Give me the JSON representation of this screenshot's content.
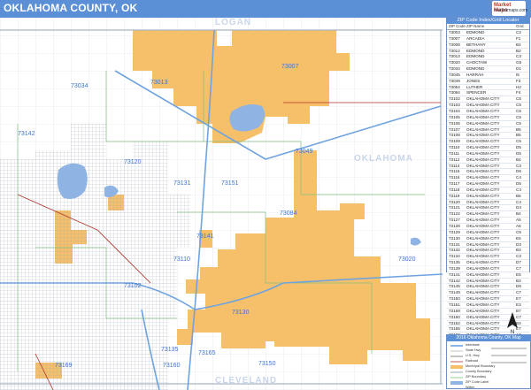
{
  "header": {
    "title": "OKLAHOMA COUNTY, OK",
    "brand_line1": "Market Maps",
    "brand_line2": "marketmaps.com"
  },
  "counties": {
    "north": "LOGAN",
    "east": "OKLAHOMA",
    "south": "CLEVELAND"
  },
  "zip_labels": [
    {
      "id": "z73007",
      "text": "73007"
    },
    {
      "id": "z73013",
      "text": "73013"
    },
    {
      "id": "z73034",
      "text": "73034"
    },
    {
      "id": "z73142",
      "text": "73142"
    },
    {
      "id": "z73120",
      "text": "73120"
    },
    {
      "id": "z73131",
      "text": "73131"
    },
    {
      "id": "z73151",
      "text": "73151"
    },
    {
      "id": "z73049",
      "text": "73049"
    },
    {
      "id": "z73084",
      "text": "73084"
    },
    {
      "id": "z73141",
      "text": "73141"
    },
    {
      "id": "z73130",
      "text": "73130"
    },
    {
      "id": "z73110",
      "text": "73110"
    },
    {
      "id": "z73150",
      "text": "73150"
    },
    {
      "id": "z73165",
      "text": "73165"
    },
    {
      "id": "z73160",
      "text": "73160"
    },
    {
      "id": "z73135",
      "text": "73135"
    },
    {
      "id": "z73169",
      "text": "73169"
    },
    {
      "id": "z73020",
      "text": "73020"
    },
    {
      "id": "z73102",
      "text": "73102"
    }
  ],
  "locator": {
    "title": "ZIP Code Index/Grid Locator",
    "col_zip": "ZIP Code",
    "col_name": "ZIP Name",
    "col_grid": "Grid",
    "rows": [
      {
        "zip": "73003",
        "name": "EDMOND",
        "grid": "C2"
      },
      {
        "zip": "73007",
        "name": "ARCADIA",
        "grid": "F1"
      },
      {
        "zip": "73008",
        "name": "BETHANY",
        "grid": "B4"
      },
      {
        "zip": "73012",
        "name": "EDMOND",
        "grid": "B2"
      },
      {
        "zip": "73013",
        "name": "EDMOND",
        "grid": "C3"
      },
      {
        "zip": "73020",
        "name": "CHOCTAW",
        "grid": "G5"
      },
      {
        "zip": "73034",
        "name": "EDMOND",
        "grid": "D1"
      },
      {
        "zip": "73045",
        "name": "HARRAH",
        "grid": "I5"
      },
      {
        "zip": "73049",
        "name": "JONES",
        "grid": "F3"
      },
      {
        "zip": "73054",
        "name": "LUTHER",
        "grid": "H2"
      },
      {
        "zip": "73084",
        "name": "SPENCER",
        "grid": "F4"
      },
      {
        "zip": "73102",
        "name": "OKLAHOMA CITY",
        "grid": "C5"
      },
      {
        "zip": "73103",
        "name": "OKLAHOMA CITY",
        "grid": "C5"
      },
      {
        "zip": "73104",
        "name": "OKLAHOMA CITY",
        "grid": "C5"
      },
      {
        "zip": "73105",
        "name": "OKLAHOMA CITY",
        "grid": "C5"
      },
      {
        "zip": "73106",
        "name": "OKLAHOMA CITY",
        "grid": "C5"
      },
      {
        "zip": "73107",
        "name": "OKLAHOMA CITY",
        "grid": "B5"
      },
      {
        "zip": "73108",
        "name": "OKLAHOMA CITY",
        "grid": "B5"
      },
      {
        "zip": "73109",
        "name": "OKLAHOMA CITY",
        "grid": "C6"
      },
      {
        "zip": "73110",
        "name": "OKLAHOMA CITY",
        "grid": "D5"
      },
      {
        "zip": "73111",
        "name": "OKLAHOMA CITY",
        "grid": "D5"
      },
      {
        "zip": "73112",
        "name": "OKLAHOMA CITY",
        "grid": "B4"
      },
      {
        "zip": "73114",
        "name": "OKLAHOMA CITY",
        "grid": "C3"
      },
      {
        "zip": "73115",
        "name": "OKLAHOMA CITY",
        "grid": "D6"
      },
      {
        "zip": "73116",
        "name": "OKLAHOMA CITY",
        "grid": "C4"
      },
      {
        "zip": "73117",
        "name": "OKLAHOMA CITY",
        "grid": "D5"
      },
      {
        "zip": "73118",
        "name": "OKLAHOMA CITY",
        "grid": "C4"
      },
      {
        "zip": "73119",
        "name": "OKLAHOMA CITY",
        "grid": "B6"
      },
      {
        "zip": "73120",
        "name": "OKLAHOMA CITY",
        "grid": "C4"
      },
      {
        "zip": "73121",
        "name": "OKLAHOMA CITY",
        "grid": "D4"
      },
      {
        "zip": "73122",
        "name": "OKLAHOMA CITY",
        "grid": "B4"
      },
      {
        "zip": "73127",
        "name": "OKLAHOMA CITY",
        "grid": "A5"
      },
      {
        "zip": "73128",
        "name": "OKLAHOMA CITY",
        "grid": "A6"
      },
      {
        "zip": "73129",
        "name": "OKLAHOMA CITY",
        "grid": "C6"
      },
      {
        "zip": "73130",
        "name": "OKLAHOMA CITY",
        "grid": "E6"
      },
      {
        "zip": "73131",
        "name": "OKLAHOMA CITY",
        "grid": "D3"
      },
      {
        "zip": "73132",
        "name": "OKLAHOMA CITY",
        "grid": "B3"
      },
      {
        "zip": "73134",
        "name": "OKLAHOMA CITY",
        "grid": "C3"
      },
      {
        "zip": "73135",
        "name": "OKLAHOMA CITY",
        "grid": "D7"
      },
      {
        "zip": "73139",
        "name": "OKLAHOMA CITY",
        "grid": "C7"
      },
      {
        "zip": "73141",
        "name": "OKLAHOMA CITY",
        "grid": "E5"
      },
      {
        "zip": "73142",
        "name": "OKLAHOMA CITY",
        "grid": "B3"
      },
      {
        "zip": "73145",
        "name": "OKLAHOMA CITY",
        "grid": "D6"
      },
      {
        "zip": "73149",
        "name": "OKLAHOMA CITY",
        "grid": "C7"
      },
      {
        "zip": "73150",
        "name": "OKLAHOMA CITY",
        "grid": "E7"
      },
      {
        "zip": "73151",
        "name": "OKLAHOMA CITY",
        "grid": "E3"
      },
      {
        "zip": "73159",
        "name": "OKLAHOMA CITY",
        "grid": "B7"
      },
      {
        "zip": "73160",
        "name": "OKLAHOMA CITY",
        "grid": "C7"
      },
      {
        "zip": "73162",
        "name": "OKLAHOMA CITY",
        "grid": "B3"
      },
      {
        "zip": "73165",
        "name": "OKLAHOMA CITY",
        "grid": "E7"
      },
      {
        "zip": "73169",
        "name": "OKLAHOMA CITY",
        "grid": "A7"
      },
      {
        "zip": "73170",
        "name": "OKLAHOMA CITY",
        "grid": "B7"
      },
      {
        "zip": "73173",
        "name": "OKLAHOMA CITY",
        "grid": "A8"
      },
      {
        "zip": "73179",
        "name": "OKLAHOMA CITY",
        "grid": "A6"
      }
    ]
  },
  "legend": {
    "title": "2016 Oklahoma County, OK Map",
    "items": [
      "Interstate",
      "State Hwy",
      "U.S. Hwy",
      "Railroad",
      "Municipal Boundary",
      "County Boundary",
      "ZIP Boundary",
      "ZIP Code Label",
      "Water"
    ]
  },
  "colors": {
    "header": "#5b8fd6",
    "municipal": "#f6c06a",
    "water": "#8fb4e3",
    "road": "#cfd6df",
    "zipline": "#7fbf7f",
    "interstate": "#6fa3e0",
    "railroad": "#b0322b"
  }
}
